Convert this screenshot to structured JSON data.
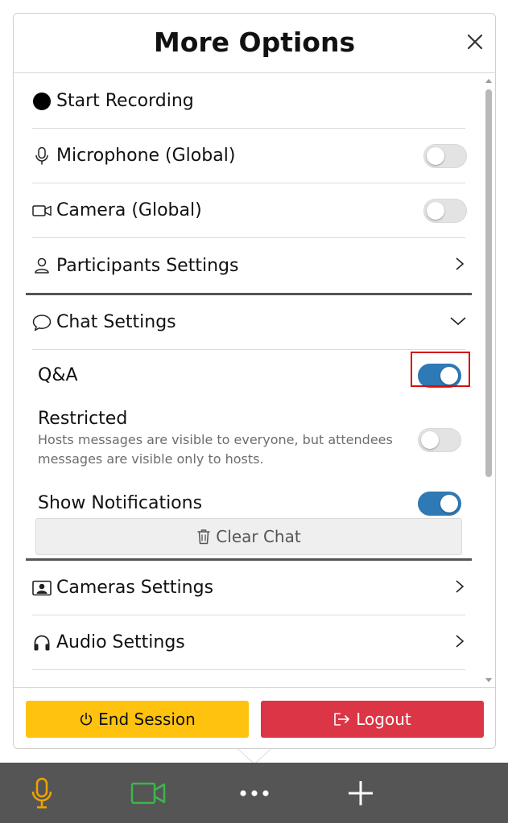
{
  "panel": {
    "title": "More Options"
  },
  "menu": {
    "start_recording": "Start Recording",
    "microphone": "Microphone (Global)",
    "camera": "Camera (Global)",
    "participants": "Participants Settings",
    "chat": "Chat Settings",
    "cameras": "Cameras Settings",
    "audio": "Audio Settings"
  },
  "toggles": {
    "microphone": false,
    "camera": false,
    "qa": true,
    "restricted": false,
    "notifications": true
  },
  "chat_settings": {
    "qa_label": "Q&A",
    "restricted_label": "Restricted",
    "restricted_desc": "Hosts messages are visible to everyone, but attendees messages are visible only to hosts.",
    "notifications_label": "Show Notifications",
    "clear_chat": "Clear Chat"
  },
  "footer": {
    "end_session": "End Session",
    "logout": "Logout"
  },
  "colors": {
    "toggle_on": "#2f79b4",
    "end_session": "#ffc20e",
    "logout": "#dc3545",
    "mic_icon": "#f0a300",
    "camera_icon": "#3fb34f",
    "bottom_bar": "#555555"
  },
  "icons": {
    "recording": "record-dot-icon",
    "microphone": "microphone-icon",
    "camera": "camera-icon",
    "participants": "person-icon",
    "chat": "chat-bubble-icon",
    "cameras": "portrait-icon",
    "audio": "headphones-icon",
    "trash": "trash-icon",
    "power": "power-icon",
    "logout": "logout-icon"
  }
}
